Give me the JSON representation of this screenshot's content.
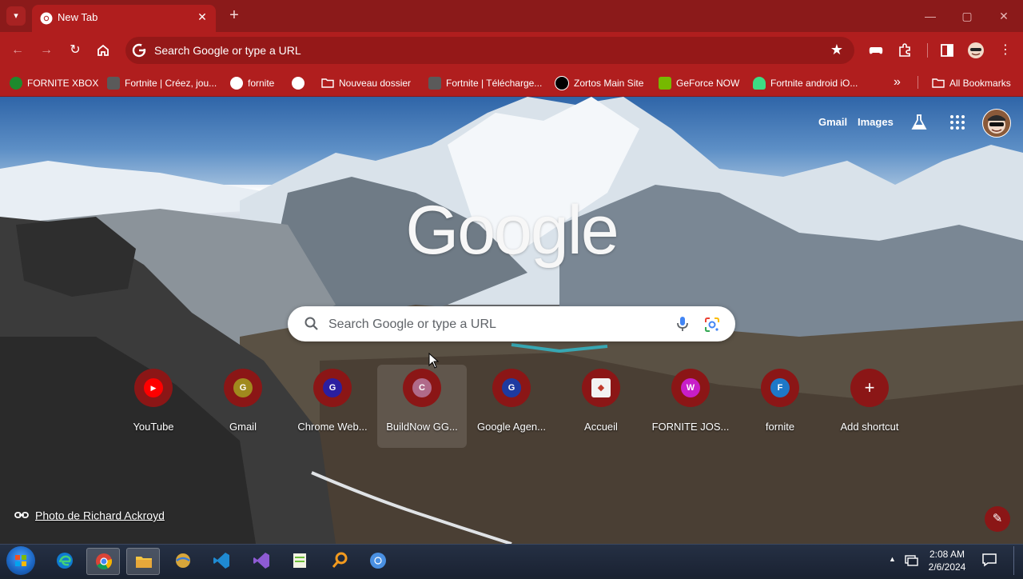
{
  "tab": {
    "title": "New Tab",
    "close": "✕",
    "new_tab": "+"
  },
  "window_controls": {
    "minimize": "—",
    "maximize": "▢",
    "close": "✕"
  },
  "toolbar": {
    "back": "←",
    "forward": "→",
    "reload": "↻",
    "omnibox_text": "Search Google or type a URL",
    "star": "★"
  },
  "bookmarks": {
    "items": [
      {
        "label": "FORNITE XBOX",
        "color": "#1e8a2d"
      },
      {
        "label": "Fortnite | Créez, jou...",
        "color": "#5a5a5a"
      },
      {
        "label": "fornite",
        "color": "#ffffff"
      },
      {
        "label": "",
        "color": "#ffffff"
      },
      {
        "label": "Nouveau dossier",
        "color": "transparent"
      },
      {
        "label": "Fortnite | Télécharge...",
        "color": "#5a5a5a"
      },
      {
        "label": "Zortos Main Site",
        "color": "#000000"
      },
      {
        "label": "GeForce NOW",
        "color": "#76b900"
      },
      {
        "label": "Fortnite android iO...",
        "color": "#3ddc84"
      }
    ],
    "overflow": "»",
    "all_bookmarks": "All Bookmarks"
  },
  "ntp": {
    "gmail": "Gmail",
    "images": "Images",
    "logo": "Google",
    "search_placeholder": "Search Google or type a URL",
    "shortcuts": [
      {
        "label": "YouTube",
        "letter": "▶",
        "color": "#ff0000"
      },
      {
        "label": "Gmail",
        "letter": "G",
        "color": "#a08a1e"
      },
      {
        "label": "Chrome Web...",
        "letter": "G",
        "color": "#2b1ea0"
      },
      {
        "label": "BuildNow GG...",
        "letter": "C",
        "color": "#b06a8a"
      },
      {
        "label": "Google Agen...",
        "letter": "G",
        "color": "#1e3aa0"
      },
      {
        "label": "Accueil",
        "letter": "◆",
        "color": "#f2f2f2"
      },
      {
        "label": "FORNITE JOS...",
        "letter": "W",
        "color": "#c81ec8"
      },
      {
        "label": "fornite",
        "letter": "F",
        "color": "#1e78c8"
      },
      {
        "label": "Add shortcut",
        "letter": "+",
        "color": "transparent"
      }
    ],
    "attribution": "Photo de Richard Ackroyd",
    "customize": "✎"
  },
  "taskbar": {
    "clock_time": "2:08 AM",
    "clock_date": "2/6/2024",
    "tray_up": "▲"
  }
}
